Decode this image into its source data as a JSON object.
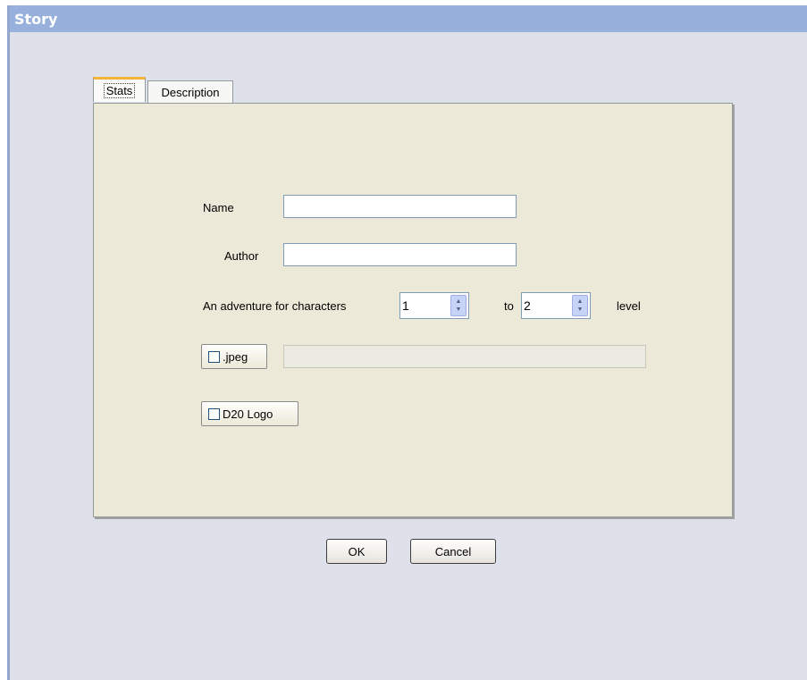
{
  "window": {
    "title": "Story"
  },
  "tabs": [
    {
      "label": "Stats",
      "active": true
    },
    {
      "label": "Description",
      "active": false
    }
  ],
  "form": {
    "name_label": "Name",
    "name_value": "",
    "author_label": "Author",
    "author_value": "",
    "adventure_label": "An adventure for characters",
    "level_from": "1",
    "to_label": "to",
    "level_to": "2",
    "level_label": "level",
    "jpeg_label": ".jpeg",
    "jpeg_path": "",
    "d20_label": "D20 Logo"
  },
  "buttons": {
    "ok": "OK",
    "cancel": "Cancel"
  },
  "icons": {
    "spinner_up": "▲",
    "spinner_down": "▼"
  }
}
